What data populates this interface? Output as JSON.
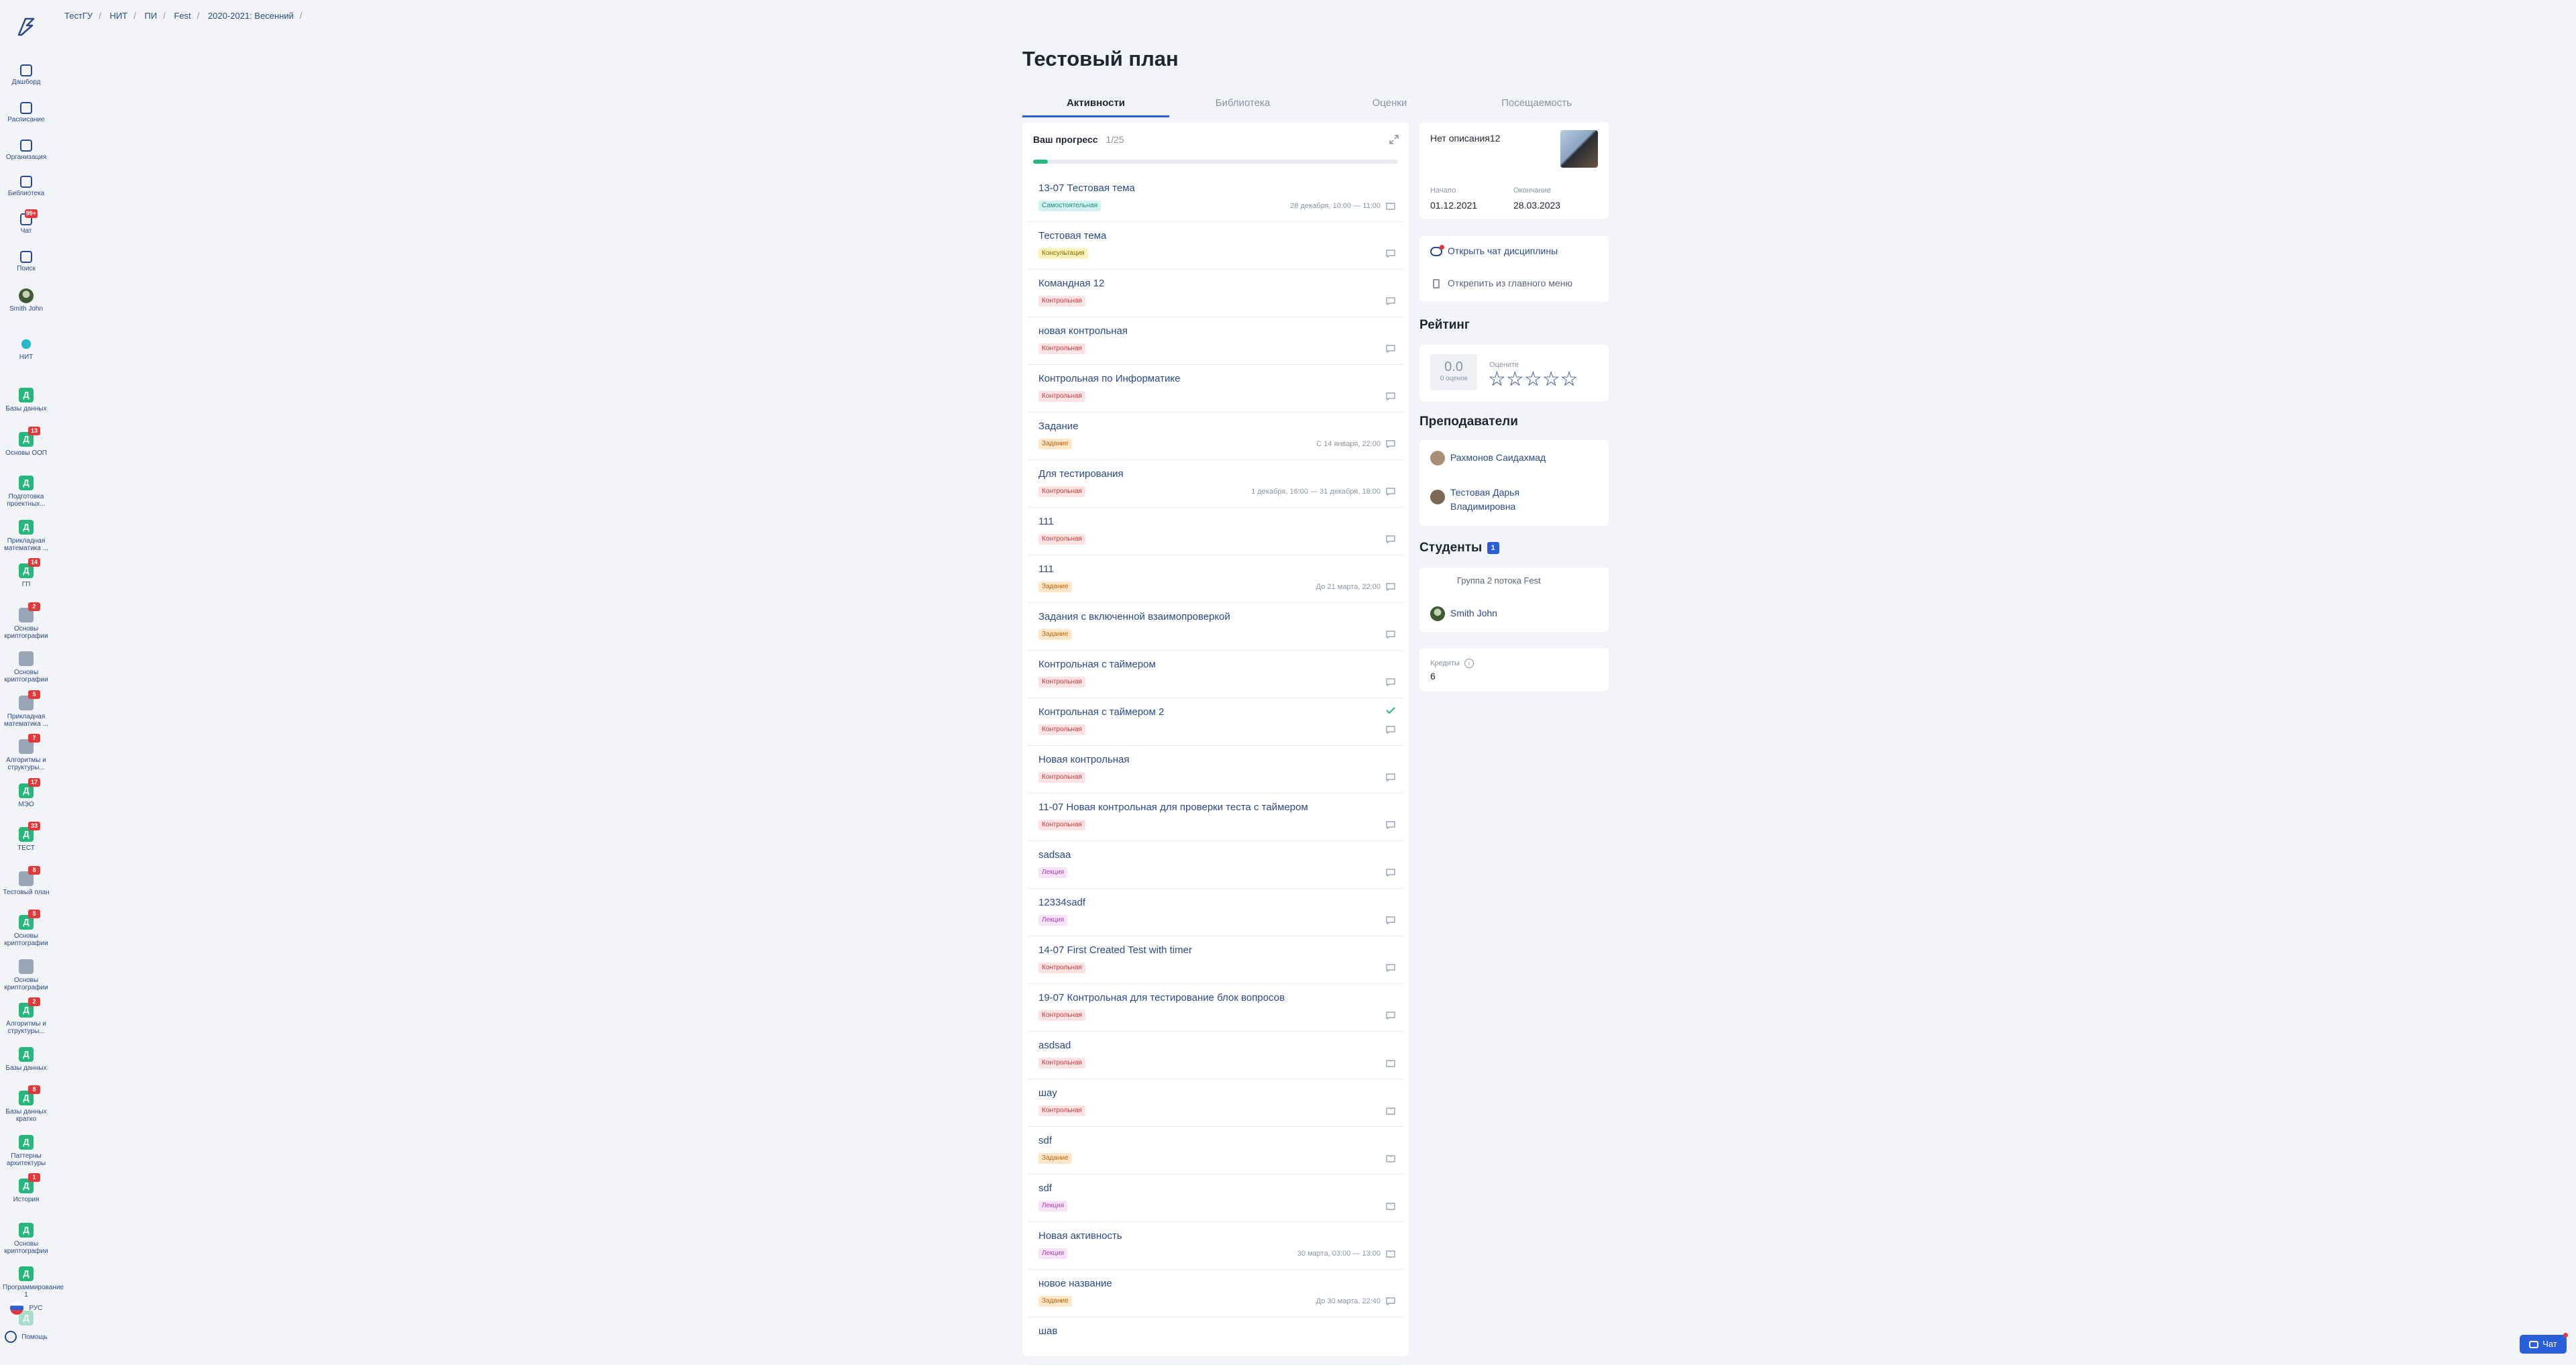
{
  "breadcrumbs": [
    "ТестГУ",
    "НИТ",
    "ПИ",
    "Fest",
    "2020-2021: Весенний"
  ],
  "nav": [
    {
      "label": "Дашборд",
      "icon": "dashboard-icon"
    },
    {
      "label": "Расписание",
      "icon": "calendar-icon"
    },
    {
      "label": "Организация",
      "icon": "home-icon"
    },
    {
      "label": "Библиотека",
      "icon": "book-icon"
    },
    {
      "label": "Чат",
      "icon": "chat-icon",
      "badge": "99+"
    },
    {
      "label": "Поиск",
      "icon": "search-icon"
    },
    {
      "label": "Smith John",
      "icon": "avatar"
    },
    {
      "label": "НИТ",
      "icon": "org-logo-icon"
    }
  ],
  "courses": [
    {
      "letter": "Д",
      "label": "Базы данных",
      "badge": ""
    },
    {
      "letter": "Д",
      "label": "Основы ООП",
      "badge": "13"
    },
    {
      "letter": "Д",
      "label": "Подготовка проектных...",
      "badge": ""
    },
    {
      "letter": "Д",
      "label": "Прикладная математика ...",
      "badge": ""
    },
    {
      "letter": "Д",
      "label": "ГП",
      "badge": "14"
    },
    {
      "letter": "",
      "label": "Основы криптографии",
      "badge": "2",
      "img": true
    },
    {
      "letter": "",
      "label": "Основы криптографии",
      "badge": "",
      "img": true
    },
    {
      "letter": "",
      "label": "Прикладная математика ...",
      "badge": "5",
      "img": true
    },
    {
      "letter": "",
      "label": "Алгоритмы и структуры...",
      "badge": "7",
      "img": true
    },
    {
      "letter": "Д",
      "label": "МЭО",
      "badge": "17"
    },
    {
      "letter": "Д",
      "label": "ТЕСТ",
      "badge": "33"
    },
    {
      "letter": "",
      "label": "Тестовый план",
      "badge": "8",
      "img": true
    },
    {
      "letter": "Д",
      "label": "Основы криптографии",
      "badge": "5"
    },
    {
      "letter": "",
      "label": "Основы криптографии",
      "badge": "",
      "img": true
    },
    {
      "letter": "Д",
      "label": "Алгоритмы и структуры...",
      "badge": "2"
    },
    {
      "letter": "Д",
      "label": "Базы данных",
      "badge": ""
    },
    {
      "letter": "Д",
      "label": "Базы данных кратко",
      "badge": "8"
    },
    {
      "letter": "Д",
      "label": "Паттерны архитектуры",
      "badge": ""
    },
    {
      "letter": "Д",
      "label": "История",
      "badge": "1"
    },
    {
      "letter": "Д",
      "label": "Основы криптографии",
      "badge": ""
    },
    {
      "letter": "Д",
      "label": "Программирование 1",
      "badge": ""
    },
    {
      "letter": "Д",
      "label": "",
      "badge": ""
    }
  ],
  "language": "РУС",
  "help": "Помощь",
  "title": "Тестовый план",
  "tabs": [
    "Активности",
    "Библиотека",
    "Оценки",
    "Посещаемость"
  ],
  "progress": {
    "label": "Ваш прогресс",
    "count": "1/25",
    "fraction": 0.04
  },
  "activities": [
    {
      "title": "13-07 Тестовая тема",
      "tag": "Самостоятельная",
      "kind": "self",
      "date": "28 декабря, 10:00 — 11:00",
      "icon": "book-icon"
    },
    {
      "title": "Тестовая тема",
      "tag": "Консультация",
      "kind": "cons",
      "date": "",
      "icon": "comment-icon"
    },
    {
      "title": "Командная 12",
      "tag": "Контрольная",
      "kind": "ctrl",
      "date": "",
      "icon": "comment-icon"
    },
    {
      "title": "новая контрольная",
      "tag": "Контрольная",
      "kind": "ctrl",
      "date": "",
      "icon": "comment-icon"
    },
    {
      "title": "Контрольная по Информатике",
      "tag": "Контрольная",
      "kind": "ctrl",
      "date": "",
      "icon": "comment-icon"
    },
    {
      "title": "Задание",
      "tag": "Задание",
      "kind": "task",
      "date": "С 14 января, 22:00",
      "icon": "comment-icon"
    },
    {
      "title": "Для тестирования",
      "tag": "Контрольная",
      "kind": "ctrl",
      "date": "1 декабря, 16:00 — 31 декабря, 18:00",
      "icon": "comment-icon"
    },
    {
      "title": "111",
      "tag": "Контрольная",
      "kind": "ctrl",
      "date": "",
      "icon": "comment-icon"
    },
    {
      "title": "111",
      "tag": "Задание",
      "kind": "task",
      "date": "До 21 марта, 22:00",
      "icon": "comment-icon"
    },
    {
      "title": "Задания с включенной взаимопроверкой",
      "tag": "Задание",
      "kind": "task",
      "date": "",
      "icon": "comment-icon"
    },
    {
      "title": "Контрольная с таймером",
      "tag": "Контрольная",
      "kind": "ctrl",
      "date": "",
      "icon": "comment-icon"
    },
    {
      "title": "Контрольная с таймером 2",
      "tag": "Контрольная",
      "kind": "ctrl",
      "date": "",
      "icon": "comment-icon",
      "done": true
    },
    {
      "title": "Новая контрольная",
      "tag": "Контрольная",
      "kind": "ctrl",
      "date": "",
      "icon": "comment-icon"
    },
    {
      "title": "11-07 Новая контрольная для проверки теста с таймером",
      "tag": "Контрольная",
      "kind": "ctrl",
      "date": "",
      "icon": "comment-icon"
    },
    {
      "title": "sadsaa",
      "tag": "Лекция",
      "kind": "lect",
      "date": "",
      "icon": "comment-icon"
    },
    {
      "title": "12334sadf",
      "tag": "Лекция",
      "kind": "lect",
      "date": "",
      "icon": "comment-icon"
    },
    {
      "title": "14-07 First Created Test with timer",
      "tag": "Контрольная",
      "kind": "ctrl",
      "date": "",
      "icon": "comment-icon"
    },
    {
      "title": "19-07 Контрольная для тестирование блок вопросов",
      "tag": "Контрольная",
      "kind": "ctrl",
      "date": "",
      "icon": "comment-icon"
    },
    {
      "title": "asdsad",
      "tag": "Контрольная",
      "kind": "ctrl",
      "date": "",
      "icon": "book-icon"
    },
    {
      "title": "шау",
      "tag": "Контрольная",
      "kind": "ctrl",
      "date": "",
      "icon": "book-icon"
    },
    {
      "title": "sdf",
      "tag": "Задание",
      "kind": "task",
      "date": "",
      "icon": "book-icon"
    },
    {
      "title": "sdf",
      "tag": "Лекция",
      "kind": "lect",
      "date": "",
      "icon": "book-icon"
    },
    {
      "title": "Новая активность",
      "tag": "Лекция",
      "kind": "lect",
      "date": "30 марта, 03:00 — 13:00",
      "icon": "book-icon"
    },
    {
      "title": "новое название",
      "tag": "Задание",
      "kind": "task",
      "date": "До 30 марта, 22:40",
      "icon": "comment-icon"
    },
    {
      "title": "шав",
      "tag": "",
      "kind": "",
      "date": "",
      "icon": ""
    }
  ],
  "info": {
    "description": "Нет описания12",
    "start_label": "Начало",
    "start": "01.12.2021",
    "end_label": "Окончание",
    "end": "28.03.2023"
  },
  "actions": {
    "open_chat": "Открыть чат дисциплины",
    "unpin": "Открепить из главного меню"
  },
  "rating": {
    "heading": "Рейтинг",
    "score": "0.0",
    "count": "0 оценок",
    "rate_label": "Оцените",
    "stars": 0
  },
  "teachers": {
    "heading": "Преподаватели",
    "list": [
      "Рахмонов Саидахмад",
      "Тестовая Дарья Владимировна"
    ]
  },
  "students": {
    "heading": "Студенты",
    "count": "1",
    "group": "Группа 2 потока Fest",
    "list": [
      "Smith John"
    ]
  },
  "credits": {
    "label": "Кредиты",
    "value": "6"
  },
  "chat_button": "Чат",
  "colors": {
    "accent": "#2b5fd9",
    "link": "#2b4a8a",
    "green": "#27b77c",
    "badge": "#e5383b"
  }
}
